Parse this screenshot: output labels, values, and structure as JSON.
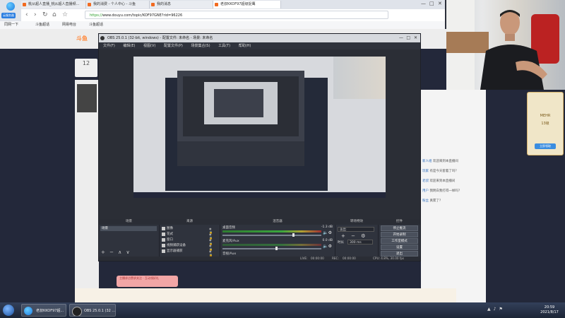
{
  "browser": {
    "logo_label": "云服务器",
    "tabs": [
      {
        "label": "桃从超人直播_桃从超人直播频..."
      },
      {
        "label": "我的消费 - 个人中心 - 斗鱼"
      },
      {
        "label": "我的消息"
      },
      {
        "label": "老叔KKOF97超级捉鹰"
      }
    ],
    "url_secure": "https://",
    "url_rest": "www.douyu.com/topic/KOF97GNE?rid=96226",
    "bookmarks": [
      "同网一下",
      "斗鱼超话",
      "网易电台",
      "斗鱼超话"
    ]
  },
  "page": {
    "brand": "斗鱼",
    "rank_number": "12",
    "chat": [
      {
        "nick": "新人组",
        "text": "欢迎来到本直播间"
      },
      {
        "nick": "玩家",
        "text": "有是今天套着了吗？"
      },
      {
        "nick": "老叔",
        "text": "欢迎来到本直播间"
      },
      {
        "nick": "用户",
        "text": "我明白我打得一样吗？"
      },
      {
        "nick": "粉丝",
        "text": "真累了？"
      }
    ],
    "badge_title": "MEHR",
    "badge_level": "13级",
    "badge_button": "立即领取",
    "red_pill_text": "主播求点赞求关注 · 互动领好礼"
  },
  "obs": {
    "title": "OBS 25.0.1 (32-bit, windows) - 配置文件: 未命名 - 场景: 未命名",
    "menu": [
      "文件(F)",
      "编辑(E)",
      "视图(V)",
      "配置文件(P)",
      "场景集合(S)",
      "工具(T)",
      "帮助(H)"
    ],
    "dock_headers": {
      "scenes": "场景",
      "sources": "来源",
      "mixer": "混音器",
      "transitions": "转场特效",
      "controls": "控件"
    },
    "scenes": [
      "场景"
    ],
    "sources": [
      "图像",
      "花式",
      "窗口",
      "视频捕获设备",
      "显示器捕获"
    ],
    "mixer": [
      {
        "label": "桌面音频",
        "db": "-1.3 dB",
        "level": 0.72
      },
      {
        "label": "麦克风/Aux",
        "db": "0.0 dB",
        "level": 0.55
      }
    ],
    "mixer_extra_label": "音视/Aux",
    "transition": {
      "selected": "淡出",
      "duration_label": "时长",
      "duration_value": "300 ms"
    },
    "controls": [
      "停止推流",
      "开始录制",
      "工作室模式",
      "设置",
      "退出"
    ],
    "dock_buttons": "+ − ∧ ∨",
    "status": {
      "live_label": "LIVE:",
      "live_time": "00:00:00",
      "rec_label": "REC:",
      "rec_time": "00:00:00",
      "cpu": "CPU: 4.8%, 30.00 fps"
    }
  },
  "taskbar": {
    "items": [
      {
        "label": "老叔KKOF97超..."
      },
      {
        "label": "OBS 25.0.1 (32 ..."
      }
    ],
    "time": "20:59",
    "date": "2021/8/17"
  },
  "colors": {
    "obs_bg": "#3c404b",
    "page_dark": "#23283a",
    "taskbar": "#1c2536"
  }
}
